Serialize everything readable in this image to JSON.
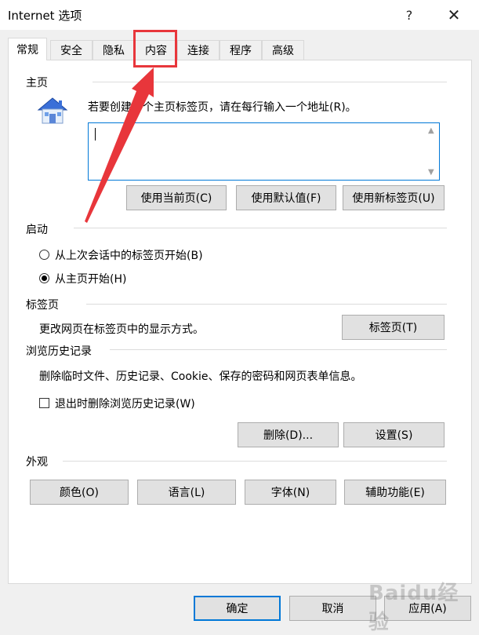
{
  "window": {
    "title": "Internet 选项",
    "help_glyph": "?",
    "close_glyph": "✕"
  },
  "tabs": [
    {
      "label": "常规",
      "active": true
    },
    {
      "label": "安全",
      "active": false
    },
    {
      "label": "隐私",
      "active": false
    },
    {
      "label": "内容",
      "active": false
    },
    {
      "label": "连接",
      "active": false
    },
    {
      "label": "程序",
      "active": false
    },
    {
      "label": "高级",
      "active": false
    }
  ],
  "homepage": {
    "section_label": "主页",
    "instruction": "若要创建多个主页标签页，请在每行输入一个地址(R)。",
    "value": "",
    "buttons": {
      "use_current": "使用当前页(C)",
      "use_default": "使用默认值(F)",
      "use_new_tab": "使用新标签页(U)"
    }
  },
  "startup": {
    "section_label": "启动",
    "option_last_session": "从上次会话中的标签页开始(B)",
    "option_homepage": "从主页开始(H)",
    "selected": "option_homepage"
  },
  "tabs_section": {
    "section_label": "标签页",
    "description": "更改网页在标签页中的显示方式。",
    "button": "标签页(T)"
  },
  "history": {
    "section_label": "浏览历史记录",
    "description": "删除临时文件、历史记录、Cookie、保存的密码和网页表单信息。",
    "checkbox_label": "退出时删除浏览历史记录(W)",
    "checkbox_checked": false,
    "delete_button": "删除(D)...",
    "settings_button": "设置(S)"
  },
  "appearance": {
    "section_label": "外观",
    "colors": "颜色(O)",
    "languages": "语言(L)",
    "fonts": "字体(N)",
    "accessibility": "辅助功能(E)"
  },
  "footer": {
    "ok": "确定",
    "cancel": "取消",
    "apply": "应用(A)"
  },
  "watermark": "Baidu经验",
  "colors": {
    "accent": "#0078d7",
    "annotation": "#e8363b"
  }
}
